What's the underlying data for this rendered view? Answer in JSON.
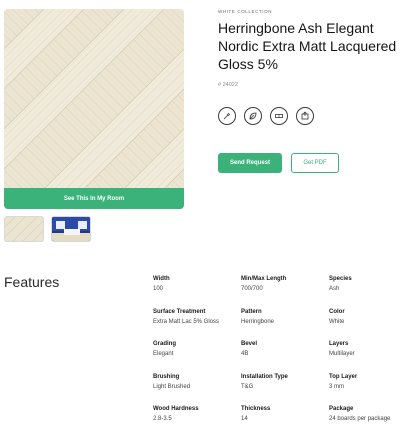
{
  "gallery": {
    "room_button_label": "See This In My Room",
    "thumbnails": [
      "floor-texture-thumbnail",
      "room-scene-thumbnail"
    ]
  },
  "product": {
    "collection": "WHITE COLLECTION",
    "title": "Herringbone Ash Elegant Nordic Extra Matt Lacquered Gloss 5%",
    "sku": "# 24022",
    "feature_icons": [
      "brush-icon",
      "leaf-icon",
      "plank-icon",
      "package-icon"
    ]
  },
  "actions": {
    "send_request_label": "Send Request",
    "get_pdf_label": "Get PDF"
  },
  "features": {
    "heading": "Features",
    "specs": [
      {
        "label": "Width",
        "value": "100"
      },
      {
        "label": "Min/Max Length",
        "value": "700/700"
      },
      {
        "label": "Species",
        "value": "Ash"
      },
      {
        "label": "Surface Treatment",
        "value": "Extra Matt Lac 5% Gloss"
      },
      {
        "label": "Pattern",
        "value": "Herringbone"
      },
      {
        "label": "Color",
        "value": "White"
      },
      {
        "label": "Grading",
        "value": "Elegant"
      },
      {
        "label": "Bevel",
        "value": "4B"
      },
      {
        "label": "Layers",
        "value": "Multilayer"
      },
      {
        "label": "Brushing",
        "value": "Light Brushed"
      },
      {
        "label": "Installation Type",
        "value": "T&G"
      },
      {
        "label": "Top Layer",
        "value": "3 mm"
      },
      {
        "label": "Wood Hardness",
        "value": "2.8-3.5"
      },
      {
        "label": "Thickness",
        "value": "14"
      },
      {
        "label": "Package",
        "value": "24 boards per package"
      }
    ]
  },
  "colors": {
    "accent": "#3bb27a",
    "wood_light": "#efe9d8",
    "wood_mid": "#e2dac3"
  }
}
